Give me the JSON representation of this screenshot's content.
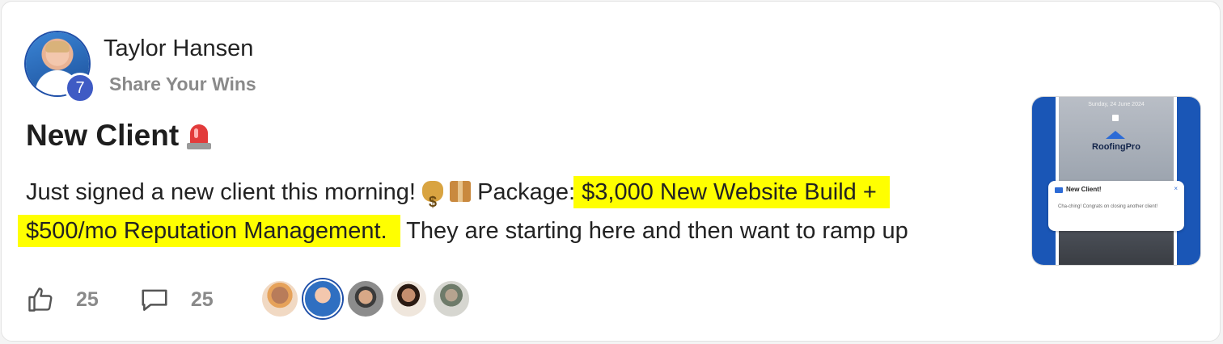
{
  "post": {
    "author": {
      "name": "Taylor Hansen",
      "level": "7"
    },
    "category": "Share Your Wins",
    "title": "New Client",
    "title_emoji_icon": "police-siren-icon",
    "body": {
      "intro": "Just signed a new client this morning!",
      "package_label": "Package:",
      "highlight_line1": "$3,000 New Website Build +",
      "highlight_line2": "$500/mo Reputation Management.",
      "outro": "They are starting here and then want to ramp up"
    },
    "likes": "25",
    "comments": "25",
    "reactor_avatars": [
      "avatar",
      "avatar",
      "avatar",
      "avatar",
      "avatar"
    ]
  },
  "thumbnail": {
    "phone_date": "Sunday, 24 June 2024",
    "brand": "RoofingPro",
    "notification": {
      "title": "New Client!",
      "close": "×",
      "body": "Cha-ching! Congrats on closing another client!"
    }
  },
  "colors": {
    "highlight": "#ffff00",
    "badge": "#3f5bc4",
    "muted": "#8a8a8a"
  }
}
